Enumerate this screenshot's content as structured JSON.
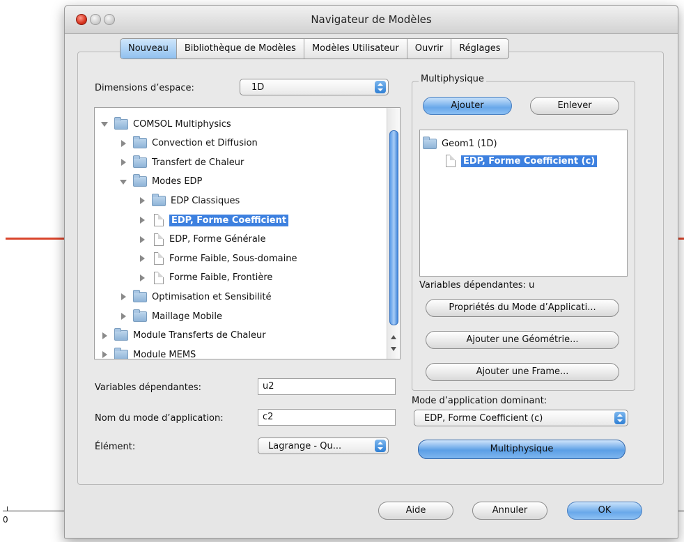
{
  "background": {
    "axis_label": "0"
  },
  "window": {
    "title": "Navigateur de Modèles",
    "tabs": [
      "Nouveau",
      "Bibliothèque de Modèles",
      "Modèles Utilisateur",
      "Ouvrir",
      "Réglages"
    ],
    "active_tab": "Nouveau"
  },
  "left": {
    "space_dim_label": "Dimensions d’espace:",
    "space_dim_value": "1D",
    "tree": [
      {
        "label": "COMSOL Multiphysics",
        "level": 0,
        "icon": "folder-icon",
        "expanded": true
      },
      {
        "label": "Convection et Diffusion",
        "level": 1,
        "icon": "folder-icon",
        "expanded": false
      },
      {
        "label": "Transfert de Chaleur",
        "level": 1,
        "icon": "folder-icon",
        "expanded": false
      },
      {
        "label": "Modes EDP",
        "level": 1,
        "icon": "folder-icon",
        "expanded": true
      },
      {
        "label": "EDP Classiques",
        "level": 2,
        "icon": "folder-icon",
        "expanded": false
      },
      {
        "label": "EDP, Forme Coefficient",
        "level": 2,
        "icon": "document-icon",
        "expanded": false,
        "selected": true
      },
      {
        "label": "EDP, Forme Générale",
        "level": 2,
        "icon": "document-icon",
        "expanded": false
      },
      {
        "label": "Forme Faible, Sous-domaine",
        "level": 2,
        "icon": "document-icon",
        "expanded": false
      },
      {
        "label": "Forme Faible, Frontière",
        "level": 2,
        "icon": "document-icon",
        "expanded": false
      },
      {
        "label": "Optimisation et Sensibilité",
        "level": 1,
        "icon": "folder-icon",
        "expanded": false
      },
      {
        "label": "Maillage Mobile",
        "level": 1,
        "icon": "folder-icon",
        "expanded": false
      },
      {
        "label": "Module Transferts de Chaleur",
        "level": 0,
        "icon": "folder-icon",
        "expanded": false
      },
      {
        "label": "Module MEMS",
        "level": 0,
        "icon": "folder-icon",
        "expanded": false
      }
    ],
    "dep_vars_label": "Variables dépendantes:",
    "dep_vars_value": "u2",
    "app_name_label": "Nom du mode d’application:",
    "app_name_value": "c2",
    "element_label": "Élément:",
    "element_value": "Lagrange - Qu..."
  },
  "right": {
    "group_title": "Multiphysique",
    "add_button": "Ajouter",
    "remove_button": "Enlever",
    "geom_label": "Geom1 (1D)",
    "geom_child": "EDP, Forme Coefficient (c)",
    "dep_vars_text": "Variables dépendantes:  u",
    "props_button": "Propriétés du Mode d’Applicati...",
    "add_geom_button": "Ajouter une Géométrie...",
    "add_frame_button": "Ajouter une Frame...",
    "dominant_label": "Mode d’application dominant:",
    "dominant_value": "EDP, Forme Coefficient (c)",
    "multiphysics_button": "Multiphysique"
  },
  "footer": {
    "help_button": "Aide",
    "cancel_button": "Annuler",
    "ok_button": "OK"
  }
}
